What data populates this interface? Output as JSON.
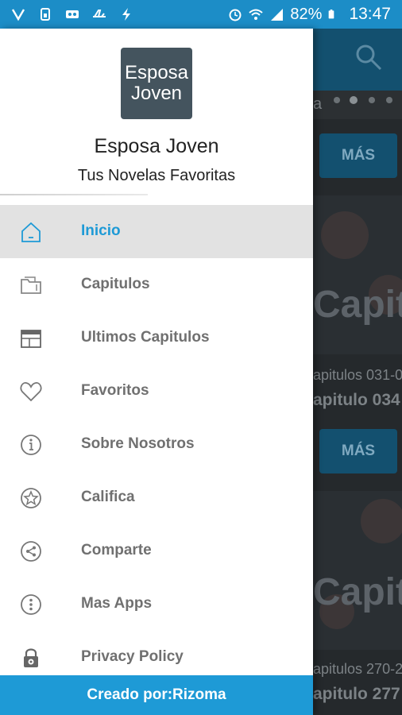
{
  "status_bar": {
    "battery_percent": "82%",
    "time": "13:47",
    "icons_left": [
      "volte-icon",
      "sim-icon",
      "voicemail-icon",
      "airplane-icon",
      "charging-icon"
    ],
    "icons_right": [
      "alarm-icon",
      "wifi-icon",
      "signal-icon",
      "battery-icon"
    ]
  },
  "drawer": {
    "logo": {
      "line1": "Esposa",
      "line2": "Joven"
    },
    "app_name": "Esposa Joven",
    "subtitle": "Tus Novelas Favoritas",
    "menu": [
      {
        "label": "Inicio",
        "icon": "home-icon",
        "active": true
      },
      {
        "label": "Capitulos",
        "icon": "folder-icon",
        "active": false
      },
      {
        "label": "Ultimos Capitulos",
        "icon": "calendar-icon",
        "active": false
      },
      {
        "label": "Favoritos",
        "icon": "heart-icon",
        "active": false
      },
      {
        "label": "Sobre Nosotros",
        "icon": "info-icon",
        "active": false
      },
      {
        "label": "Califica",
        "icon": "star-icon",
        "active": false
      },
      {
        "label": "Comparte",
        "icon": "share-icon",
        "active": false
      },
      {
        "label": "Mas Apps",
        "icon": "more-icon",
        "active": false
      },
      {
        "label": "Privacy Policy",
        "icon": "lock-icon",
        "active": false
      }
    ],
    "footer": "Creado por:Rizoma"
  },
  "background": {
    "strip_fragment": "a",
    "more_button_label": "MÁS",
    "cards": [
      {
        "banner": "Capitulo",
        "line1": "apitulos 031-0",
        "line2": "apitulo 034"
      },
      {
        "banner": "Capitulo",
        "line1": "apitulos 270-2",
        "line2": "apitulo 277"
      }
    ]
  },
  "colors": {
    "accent": "#1e9ad6",
    "status_bar": "#1c8dc7",
    "active_row": "#e2e2e2",
    "menu_text": "#707070"
  }
}
